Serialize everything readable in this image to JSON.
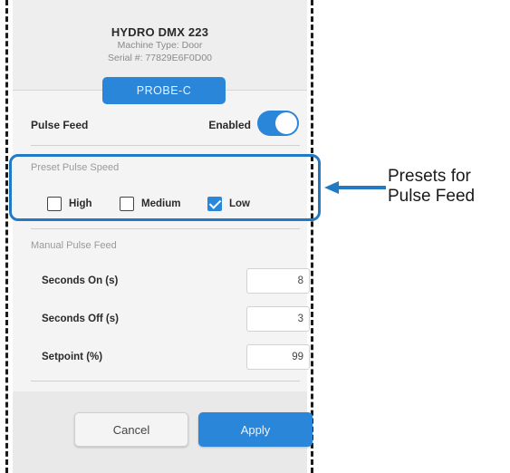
{
  "device": {
    "name": "HYDRO DMX 223",
    "machine_type": "Machine Type: Door",
    "serial": "Serial #: 77829E6F0D00"
  },
  "probe_button": "PROBE-C",
  "pulse_feed": {
    "label": "Pulse Feed",
    "status": "Enabled",
    "enabled": true
  },
  "preset": {
    "section_label": "Preset Pulse Speed",
    "options": [
      {
        "label": "High",
        "checked": false
      },
      {
        "label": "Medium",
        "checked": false
      },
      {
        "label": "Low",
        "checked": true
      }
    ]
  },
  "manual": {
    "section_label": "Manual Pulse Feed",
    "fields": [
      {
        "label": "Seconds On (s)",
        "value": "8"
      },
      {
        "label": "Seconds Off (s)",
        "value": "3"
      },
      {
        "label": "Setpoint (%)",
        "value": "99"
      }
    ]
  },
  "buttons": {
    "cancel": "Cancel",
    "apply": "Apply"
  },
  "callout": {
    "line1": "Presets for",
    "line2": "Pulse Feed"
  },
  "colors": {
    "accent": "#2a86d8",
    "highlight_box": "#2279c4"
  },
  "icons": {
    "checkbox_checked": "check-icon",
    "arrow": "arrow-left-icon"
  }
}
